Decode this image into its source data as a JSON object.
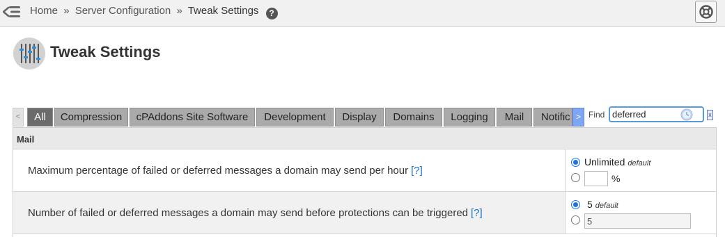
{
  "breadcrumb": {
    "home": "Home",
    "separator": "»",
    "section": "Server Configuration",
    "current": "Tweak Settings",
    "help_glyph": "?"
  },
  "icons": {
    "menu": "collapse-menu-icon",
    "help": "help-icon",
    "support": "lifebuoy-icon",
    "page": "sliders-icon",
    "find": "clock-icon",
    "clear": "close-icon"
  },
  "page": {
    "title": "Tweak Settings"
  },
  "tabs": {
    "prev_glyph": "<",
    "next_glyph": ">",
    "items": [
      {
        "label": "All",
        "active": true
      },
      {
        "label": "Compression",
        "active": false
      },
      {
        "label": "cPAddons Site Software",
        "active": false
      },
      {
        "label": "Development",
        "active": false
      },
      {
        "label": "Display",
        "active": false
      },
      {
        "label": "Domains",
        "active": false
      },
      {
        "label": "Logging",
        "active": false
      },
      {
        "label": "Mail",
        "active": false
      },
      {
        "label": "Notific",
        "active": false
      }
    ]
  },
  "find": {
    "label": "Find",
    "value": "deferred",
    "clear_glyph": "x"
  },
  "settings": {
    "section": "Mail",
    "help_link": "[?]",
    "rows": [
      {
        "label": "Maximum percentage of failed or deferred messages a domain may send per hour",
        "option1": "Unlimited",
        "option1_note": "default",
        "option2_value": "",
        "option2_unit": "%",
        "selected": "option1"
      },
      {
        "label": "Number of failed or deferred messages a domain may send before protections can be triggered",
        "option1": "5",
        "option1_note": "default",
        "option2_value": "5",
        "selected": "option1"
      }
    ]
  },
  "colors": {
    "tab_active": "#6b6b6b",
    "tab_inactive": "#aaaaaa",
    "tab_scroll_right": "#7ea6f5",
    "link": "#1a6fc8",
    "radio_selected": "#1a73e8",
    "find_border": "#5b9bd5"
  }
}
